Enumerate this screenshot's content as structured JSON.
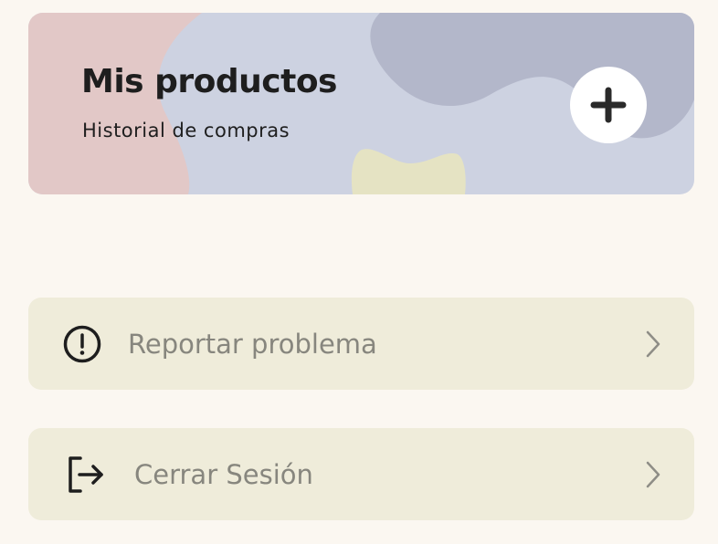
{
  "products_card": {
    "title": "Mis productos",
    "subtitle": "Historial de compras",
    "add_icon": "plus-icon"
  },
  "menu": {
    "items": [
      {
        "label": "Reportar problema",
        "icon": "alert-circle-icon",
        "chevron": "chevron-right-icon"
      },
      {
        "label": "Cerrar Sesión",
        "icon": "logout-icon",
        "chevron": "chevron-right-icon"
      }
    ]
  },
  "colors": {
    "background": "#FBF7F1",
    "card_base": "#CDD2E1",
    "card_pink": "#E2C8C7",
    "card_dark_blob": "#B3B7CA",
    "card_yellow_blob": "#E5E3C3",
    "row_background": "#EFECDA",
    "row_text": "#87867E",
    "text_dark": "#1E1E1E"
  }
}
